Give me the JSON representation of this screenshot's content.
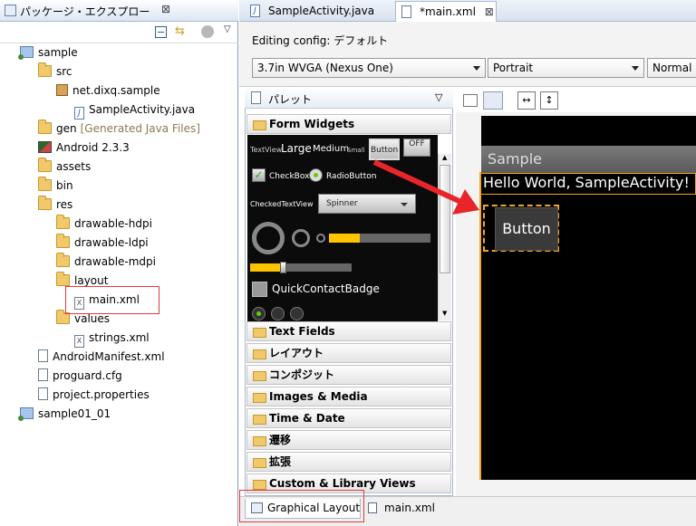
{
  "package_explorer": {
    "title": "パッケージ・エクスプロー",
    "close_glyph": "⊠",
    "tree": [
      {
        "label": "sample",
        "icon": "project-icon",
        "level": 1
      },
      {
        "label": "src",
        "icon": "folder-icon",
        "level": 2
      },
      {
        "label": "net.dixq.sample",
        "icon": "package-icon",
        "level": 3
      },
      {
        "label": "SampleActivity.java",
        "icon": "java-file-icon",
        "level": 4
      },
      {
        "label": "gen",
        "note": "[Generated Java Files]",
        "icon": "folder-icon",
        "level": 2
      },
      {
        "label": "Android 2.3.3",
        "icon": "android-library-icon",
        "level": 2
      },
      {
        "label": "assets",
        "icon": "folder-icon",
        "level": 2
      },
      {
        "label": "bin",
        "icon": "folder-icon",
        "level": 2
      },
      {
        "label": "res",
        "icon": "folder-icon",
        "level": 2
      },
      {
        "label": "drawable-hdpi",
        "icon": "folder-icon",
        "level": 3
      },
      {
        "label": "drawable-ldpi",
        "icon": "folder-icon",
        "level": 3
      },
      {
        "label": "drawable-mdpi",
        "icon": "folder-icon",
        "level": 3
      },
      {
        "label": "layout",
        "icon": "folder-icon",
        "level": 3
      },
      {
        "label": "main.xml",
        "icon": "xml-file-icon",
        "level": 4
      },
      {
        "label": "values",
        "icon": "folder-icon",
        "level": 3
      },
      {
        "label": "strings.xml",
        "icon": "xml-file-icon",
        "level": 4
      },
      {
        "label": "AndroidManifest.xml",
        "icon": "manifest-file-icon",
        "level": 2
      },
      {
        "label": "proguard.cfg",
        "icon": "file-icon",
        "level": 2
      },
      {
        "label": "project.properties",
        "icon": "file-icon",
        "level": 2
      },
      {
        "label": "sample01_01",
        "icon": "project-icon",
        "level": 1
      }
    ]
  },
  "editor_tabs": [
    {
      "label": "SampleActivity.java",
      "icon": "java-file-icon",
      "active": false
    },
    {
      "label": "*main.xml",
      "icon": "layout-file-icon",
      "active": true
    }
  ],
  "editor_tab_close_glyph": "⊠",
  "config": {
    "label": "Editing config:",
    "value": "デフォルト",
    "device": "3.7in WVGA (Nexus One)",
    "orientation": "Portrait",
    "theme": "Normal"
  },
  "palette": {
    "title": "パレット",
    "open_category": "Form Widgets",
    "categories": [
      "Text Fields",
      "レイアウト",
      "コンポジット",
      "Images & Media",
      "Time & Date",
      "遷移",
      "拡張",
      "Custom & Library Views"
    ],
    "widgets": {
      "textview_small": "TextView",
      "large": "Large",
      "medium": "Medium",
      "small": "Small",
      "button": "Button",
      "toggle": "OFF",
      "checkbox": "CheckBox",
      "radiobutton": "RadioButton",
      "checkedtextview": "CheckedTextView",
      "spinner": "Spinner",
      "quickcontact": "QuickContactBadge"
    }
  },
  "device_preview": {
    "app_title": "Sample",
    "hello_text": "Hello World, SampleActivity!",
    "button_label": "Button"
  },
  "bottom_tabs": [
    {
      "label": "Graphical Layout",
      "active": true
    },
    {
      "label": "main.xml",
      "active": false
    }
  ],
  "colors": {
    "highlight_red": "#e03a3a",
    "selection_orange": "#f5a623",
    "arrow_red": "#e8262a",
    "progress_yellow": "#ffc400"
  }
}
